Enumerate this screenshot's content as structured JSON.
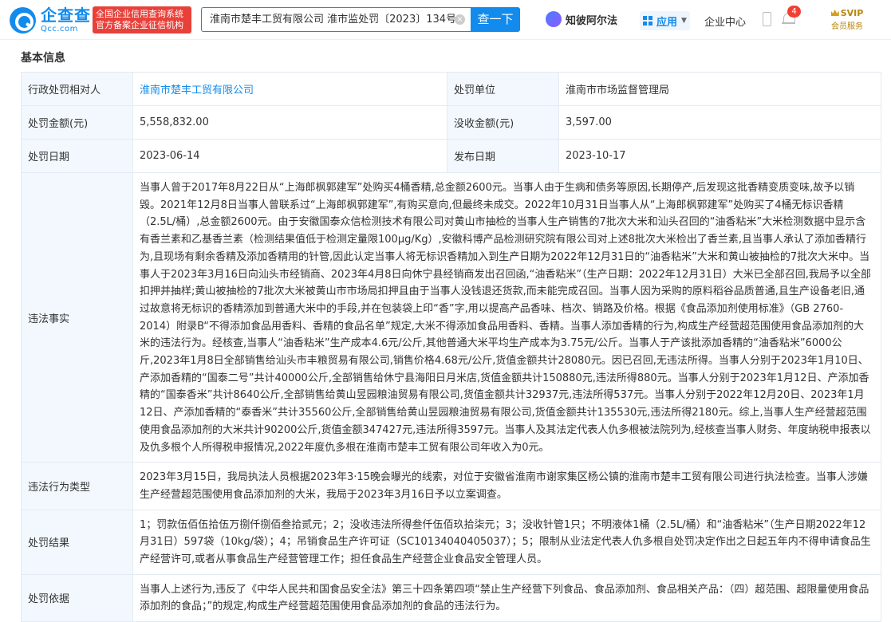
{
  "header": {
    "logo_cn": "企查查",
    "logo_en": "Qcc.com",
    "badge_line1": "全国企业信用查询系统",
    "badge_line2": "官方备案企业征信机构",
    "search_value": "淮南市楚丰工贸有限公司 淮市监处罚〔2023〕134号",
    "search_button": "查一下",
    "zhibi_label": "知彼阿尔法",
    "app_label": "应用",
    "center_label": "企业中心",
    "notification_count": "4",
    "svip_top": "SVIP",
    "svip_bottom": "会员服务"
  },
  "section": {
    "title": "基本信息"
  },
  "info": {
    "party_label": "行政处罚相对人",
    "party_value": "淮南市楚丰工贸有限公司",
    "unit_label": "处罚单位",
    "unit_value": "淮南市市场监督管理局",
    "amount_label": "处罚金额(元)",
    "amount_value": "5,558,832.00",
    "confiscation_label": "没收金额(元)",
    "confiscation_value": "3,597.00",
    "date_label": "处罚日期",
    "date_value": "2023-06-14",
    "publish_label": "发布日期",
    "publish_value": "2023-10-17",
    "facts_label": "违法事实",
    "facts_value": "当事人曾于2017年8月22日从“上海郎枫郭建军”处购买4桶香精,总金额2600元。当事人由于生病和债务等原因,长期停产,后发现这批香精变质变味,故予以销毁。2021年12月8日当事人曾联系过“上海郎枫郭建军”,有购买意向,但最终未成交。2022年10月31日当事人从“上海郎枫郭建军”处购买了4桶无标识香精（2.5L/桶）,总金额2600元。由于安徽国泰众信检测技术有限公司对黄山市抽检的当事人生产销售的7批次大米和汕头召回的“油香粘米”大米检测数据中显示含有香兰素和乙基香兰素（检测结果值低于检测定量限100μg/Kg）,安徽科博产品检测研究院有限公司对上述8批次大米检出了香兰素,且当事人承认了添加香精行为,且现场有剩余香精及添加香精用的针管,因此认定当事人将无标识香精加入到生产日期为2022年12月31日的“油香粘米”大米和黄山被抽检的7批次大米中。当事人于2023年3月16日向汕头市经销商、2023年4月8日向休宁县经销商发出召回函,“油香粘米”（生产日期：2022年12月31日）大米已全部召回,我局予以全部扣押并抽样;黄山被抽检的7批次大米被黄山市市场局扣押且由于当事人没钱退还货款,而未能完成召回。当事人因为采购的原料稻谷品质普通,且生产设备老旧,通过故意将无标识的香精添加到普通大米中的手段,并在包装袋上印“香”字,用以提高产品香味、档次、销路及价格。根据《食品添加剂使用标准》（GB 2760-2014）附录B“不得添加食品用香料、香精的食品名单”规定,大米不得添加食品用香料、香精。当事人添加香精的行为,构成生产经营超范围使用食品添加剂的大米的违法行为。经核查,当事人“油香粘米”生产成本4.6元/公斤,其他普通大米平均生产成本为3.75元/公斤。当事人于产该批添加香精的“油香粘米”6000公斤,2023年1月8日全部销售给汕头市丰粮贸易有限公司,销售价格4.68元/公斤,货值金额共计28080元。因已召回,无违法所得。当事人分别于2023年1月10日、产添加香精的“国泰二号”共计40000公斤,全部销售给休宁县海阳日月米店,货值金额共计150880元,违法所得880元。当事人分别于2023年1月12日、产添加香精的“国泰香米”共计8640公斤,全部销售给黄山昱园粮油贸易有限公司,货值金额共计32937元,违法所得537元。当事人分别于2022年12月20日、2023年1月12日、产添加香精的“泰香米”共计35560公斤,全部销售给黄山昱园粮油贸易有限公司,货值金额共计135530元,违法所得2180元。综上,当事人生产经营超范围使用食品添加剂的大米共计90200公斤,货值金额347427元,违法所得3597元。当事人及其法定代表人仇多根被法院列为,经核查当事人财务、年度纳税申报表以及仇多根个人所得税申报情况,2022年度仇多根在淮南市楚丰工贸有限公司年收入为0元。",
    "type_label": "违法行为类型",
    "type_value": "2023年3月15日，我局执法人员根据2023年3·15晚会曝光的线索，对位于安徽省淮南市谢家集区杨公镇的淮南市楚丰工贸有限公司进行执法检查。当事人涉嫌生产经营超范围使用食品添加剂的大米，我局于2023年3月16日予以立案调查。",
    "result_label": "处罚结果",
    "result_value": "1；罚款伍佰伍拾伍万捌仟捌佰叁拾贰元；2；没收违法所得叁仟伍佰玖拾柒元；3；没收针管1只；不明液体1桶（2.5L/桶）和“油香粘米”（生产日期2022年12月31日）597袋（10kg/袋）；4；吊销食品生产许可证（SC10134040405037）；5；限制从业法定代表人仇多根自处罚决定作出之日起五年内不得申请食品生产经营许可,或者从事食品生产经营管理工作；担任食品生产经营企业食品安全管理人员。",
    "basis_label": "处罚依据",
    "basis_value": "当事人上述行为,违反了《中华人民共和国食品安全法》第三十四条第四项“禁止生产经营下列食品、食品添加剂、食品相关产品：（四）超范围、超限量使用食品添加剂的食品；”的规定,构成生产经营超范围使用食品添加剂的食品的违法行为。"
  }
}
